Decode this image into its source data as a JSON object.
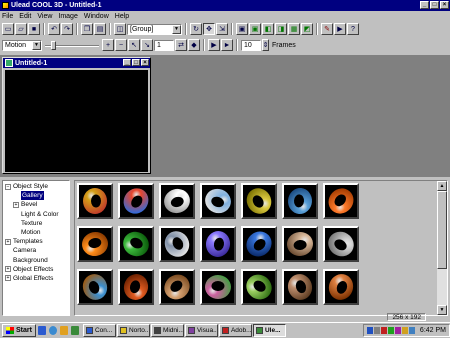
{
  "app": {
    "title": "Ulead COOL 3D - Untitled-1"
  },
  "menu": [
    "File",
    "Edit",
    "View",
    "Image",
    "Window",
    "Help"
  ],
  "toolbar1": {
    "object_combo": "[Group]"
  },
  "toolbar2": {
    "motion_combo": "Motion",
    "frame_value": "1",
    "frames_count": "10",
    "frames_label": "Frames"
  },
  "document": {
    "title": "Untitled-1"
  },
  "tree": {
    "items": [
      {
        "label": "Object Style",
        "expander": "−",
        "level": 0
      },
      {
        "label": "Gallery",
        "expander": "",
        "level": 1,
        "selected": true
      },
      {
        "label": "Bevel",
        "expander": "+",
        "level": 1
      },
      {
        "label": "Light & Color",
        "expander": "",
        "level": 1
      },
      {
        "label": "Texture",
        "expander": "",
        "level": 1
      },
      {
        "label": "Motion",
        "expander": "",
        "level": 1
      },
      {
        "label": "Templates",
        "expander": "+",
        "level": 0
      },
      {
        "label": "Camera",
        "expander": "",
        "level": 0
      },
      {
        "label": "Background",
        "expander": "",
        "level": 0
      },
      {
        "label": "Object Effects",
        "expander": "+",
        "level": 0
      },
      {
        "label": "Global Effects",
        "expander": "+",
        "level": 0
      }
    ]
  },
  "gallery": {
    "thumbs": [
      [
        "#d4a017",
        "#c0392b"
      ],
      [
        "#e8452b",
        "#2d6cdf"
      ],
      [
        "#ffffff",
        "#999999"
      ],
      [
        "#7fb0e0",
        "#e0e0e0"
      ],
      [
        "#d9c840",
        "#7a7000"
      ],
      [
        "#5aa0d8",
        "#1a4a80"
      ],
      [
        "#ff7a2a",
        "#a03a00"
      ],
      [
        "#ff8c1a",
        "#8a3a00"
      ],
      [
        "#3cb83c",
        "#0a5a0a"
      ],
      [
        "#8090a8",
        "#e8e8e8"
      ],
      [
        "#8c7aff",
        "#3a2a9a"
      ],
      [
        "#3a78e0",
        "#0a2a6a"
      ],
      [
        "#d8b89a",
        "#6a4a30"
      ],
      [
        "#d0d0d0",
        "#707070"
      ],
      [
        "#3a8fd0",
        "#a05a10"
      ],
      [
        "#e05a20",
        "#6a2000"
      ],
      [
        "#d4a070",
        "#7a4a20"
      ],
      [
        "#cc60a0",
        "#40a040"
      ],
      [
        "#9acd60",
        "#2a6a10"
      ],
      [
        "#c09070",
        "#5a3a20"
      ],
      [
        "#e08040",
        "#7a3000"
      ]
    ],
    "size_label": "256 x 192"
  },
  "taskbar": {
    "start_label": "Start",
    "tasks": [
      {
        "label": "Con...",
        "color": "#2a5ad0"
      },
      {
        "label": "Norto...",
        "color": "#e0c020"
      },
      {
        "label": "Midni...",
        "color": "#404040"
      },
      {
        "label": "Visua...",
        "color": "#8040a0"
      },
      {
        "label": "Adob...",
        "color": "#c02020"
      },
      {
        "label": "Ule...",
        "color": "#3a8a3a",
        "active": true
      }
    ],
    "clock": "6:42 PM"
  }
}
